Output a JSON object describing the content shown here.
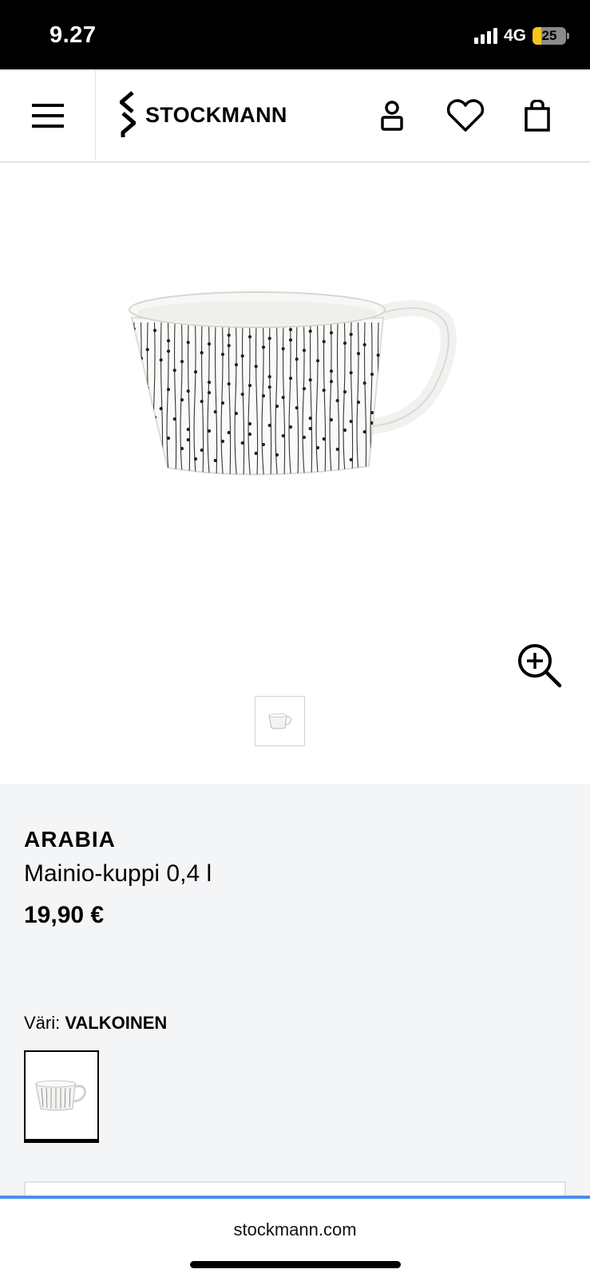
{
  "status_bar": {
    "time": "9.27",
    "network": "4G",
    "battery_level": "25",
    "battery_fraction": 0.25,
    "signal_bars": 4
  },
  "header": {
    "logo_text": "STOCKMANN",
    "icons": [
      "menu-icon",
      "account-icon",
      "wishlist-heart-icon",
      "shopping-bag-icon"
    ]
  },
  "gallery": {
    "main_image": "white cup with black vertical line and dot pattern",
    "zoom_icon": "zoom-in-icon",
    "thumbnail_count": 1
  },
  "product": {
    "brand": "ARABIA",
    "name": "Mainio-kuppi 0,4 l",
    "price": "19,90 €",
    "color_label": "Väri:",
    "color_value": "VALKOINEN"
  },
  "browser": {
    "url": "stockmann.com",
    "accent_color": "#4a8fe7"
  },
  "colors": {
    "info_background": "#f4f5f7",
    "battery_fill": "#f5c518"
  }
}
